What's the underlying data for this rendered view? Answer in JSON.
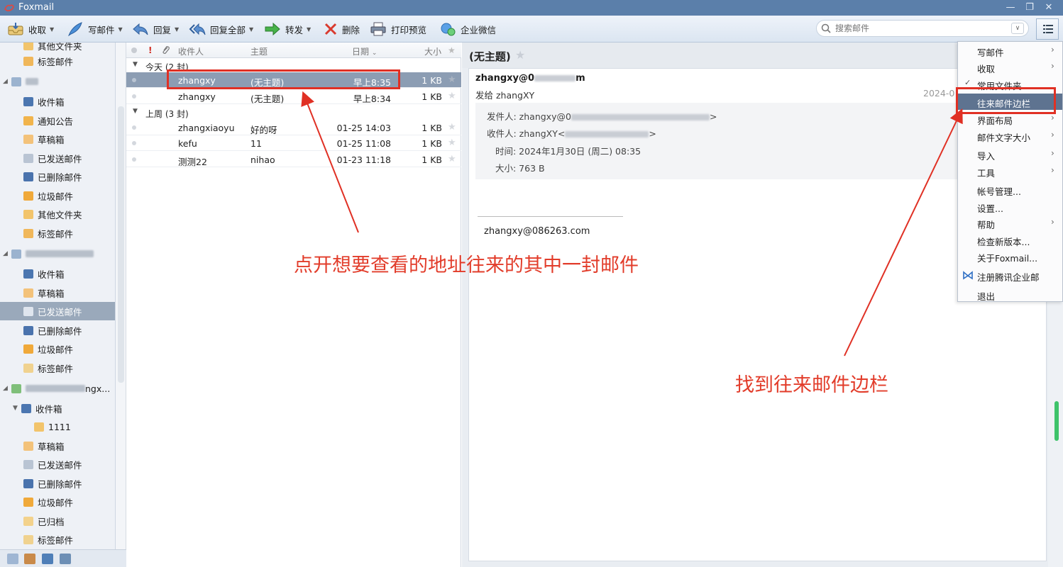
{
  "window": {
    "title": "Foxmail",
    "controls": [
      "—",
      "❐",
      "✕"
    ]
  },
  "toolbar": {
    "receive": "收取",
    "compose": "写邮件",
    "reply": "回复",
    "reply_all": "回复全部",
    "forward": "转发",
    "delete": "删除",
    "print_preview": "打印预览",
    "wecom": "企业微信",
    "search_placeholder": "搜索邮件",
    "search_dropdown": "∨"
  },
  "sidebar": {
    "items": [
      {
        "label": "其他文件夹",
        "icon": "folder-icon"
      },
      {
        "label": "标签邮件",
        "icon": "tag-folder-icon"
      },
      {
        "label": "收件箱",
        "icon": "inbox-icon"
      },
      {
        "label": "通知公告",
        "icon": "announcement-icon"
      },
      {
        "label": "草稿箱",
        "icon": "drafts-icon"
      },
      {
        "label": "已发送邮件",
        "icon": "sent-icon"
      },
      {
        "label": "已删除邮件",
        "icon": "trash-icon"
      },
      {
        "label": "垃圾邮件",
        "icon": "spam-icon"
      },
      {
        "label": "其他文件夹",
        "icon": "folder-icon"
      },
      {
        "label": "标签邮件",
        "icon": "tag-folder-icon"
      },
      {
        "label": "收件箱",
        "icon": "inbox-icon"
      },
      {
        "label": "草稿箱",
        "icon": "drafts-icon"
      },
      {
        "label": "已发送邮件",
        "icon": "sent-icon"
      },
      {
        "label": "已删除邮件",
        "icon": "trash-icon"
      },
      {
        "label": "垃圾邮件",
        "icon": "spam-icon"
      },
      {
        "label": "标签邮件",
        "icon": "tag-folder-icon"
      },
      {
        "label": "收件箱",
        "icon": "inbox-icon"
      },
      {
        "label": "1111",
        "icon": "folder-icon"
      },
      {
        "label": "草稿箱",
        "icon": "drafts-icon"
      },
      {
        "label": "已发送邮件",
        "icon": "sent-icon"
      },
      {
        "label": "已删除邮件",
        "icon": "trash-icon"
      },
      {
        "label": "垃圾邮件",
        "icon": "spam-icon"
      },
      {
        "label": "已归档",
        "icon": "archive-icon"
      },
      {
        "label": "标签邮件",
        "icon": "tag-folder-icon"
      }
    ],
    "account_3_suffix": "ngx..."
  },
  "mail_list": {
    "columns": {
      "to": "收件人",
      "subject": "主题",
      "date": "日期",
      "size": "大小"
    },
    "groups": [
      {
        "label": "今天 (2 封)"
      },
      {
        "label": "上周 (3 封)"
      }
    ],
    "rows": [
      {
        "from": "zhangxy",
        "subject": "(无主题)",
        "date": "早上8:35",
        "size": "1 KB"
      },
      {
        "from": "zhangxy",
        "subject": "(无主题)",
        "date": "早上8:34",
        "size": "1 KB"
      },
      {
        "from": "zhangxiaoyu",
        "subject": "好的呀",
        "date": "01-25 14:03",
        "size": "1 KB"
      },
      {
        "from": "kefu",
        "subject": "11",
        "date": "01-25 11:08",
        "size": "1 KB"
      },
      {
        "from": "测测22",
        "subject": "nihao",
        "date": "01-23 11:18",
        "size": "1 KB"
      }
    ]
  },
  "reader": {
    "title": "(无主题)",
    "sender_prefix": "zhangxy@0",
    "sender_suffix": "m",
    "sent_to": "发给 zhangXY",
    "date_short": "2024-0",
    "from_label": "发件人: zhangxy@0",
    "from_end": ">",
    "to_label": "收件人: zhangXY<",
    "to_end": ">",
    "time": "时间: 2024年1月30日 (周二) 08:35",
    "size": "大小: 763 B",
    "signature": "zhangxy@086263.com"
  },
  "menu": {
    "items": [
      {
        "label": "写邮件",
        "submenu": true
      },
      {
        "label": "收取",
        "submenu": true
      },
      {
        "label": "常用文件夹",
        "submenu": false,
        "checked": true
      },
      {
        "label": "往来邮件边栏",
        "submenu": false,
        "highlighted": true
      },
      {
        "label": "界面布局",
        "submenu": true
      },
      {
        "label": "邮件文字大小",
        "submenu": true
      },
      {
        "label": "导入",
        "submenu": true
      },
      {
        "label": "工具",
        "submenu": true
      },
      {
        "label": "帐号管理...",
        "submenu": false
      },
      {
        "label": "设置...",
        "submenu": false
      },
      {
        "label": "帮助",
        "submenu": true
      },
      {
        "label": "检查新版本...",
        "submenu": false
      },
      {
        "label": "关于Foxmail...",
        "submenu": false
      },
      {
        "label": "注册腾讯企业邮",
        "submenu": false,
        "icon": "tencent-exmail-icon"
      },
      {
        "label": "退出",
        "submenu": false
      }
    ]
  },
  "annotations": {
    "left_note": "点开想要查看的地址往来的其中一封邮件",
    "right_note": "找到往来邮件边栏",
    "color": "#e23c2a"
  }
}
